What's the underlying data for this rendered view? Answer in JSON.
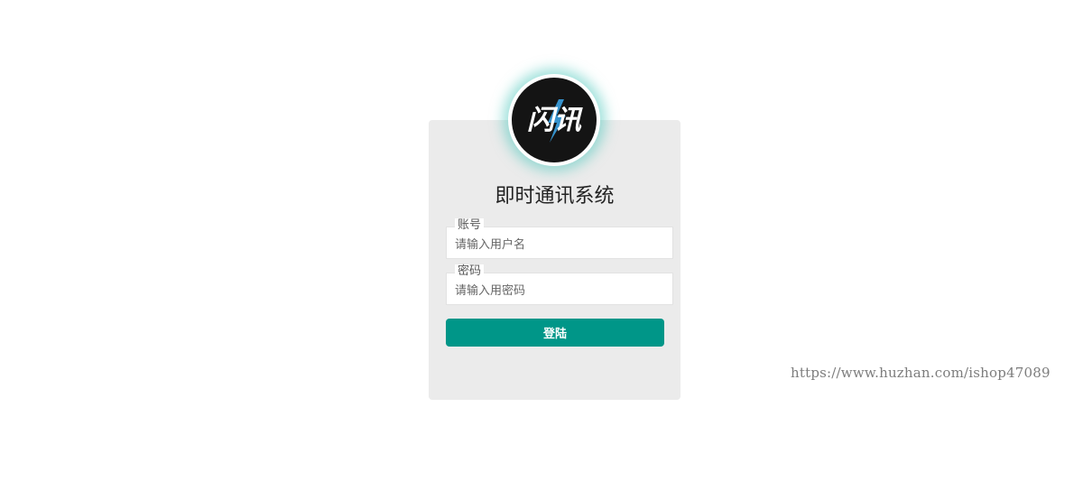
{
  "login": {
    "title": "即时通讯系统",
    "username": {
      "label": "账号",
      "placeholder": "请输入用户名",
      "value": ""
    },
    "password": {
      "label": "密码",
      "placeholder": "请输入用密码",
      "value": ""
    },
    "submit_label": "登陆"
  },
  "logo": {
    "text": "闪讯",
    "icon": "lightning-logo",
    "ring_glow_color": "#50c8be",
    "background_color": "#141414"
  },
  "watermark": {
    "text": "https://www.huzhan.com/ishop47089"
  },
  "colors": {
    "accent": "#009688",
    "card_background": "#ebebeb",
    "page_background": "#ffffff"
  }
}
